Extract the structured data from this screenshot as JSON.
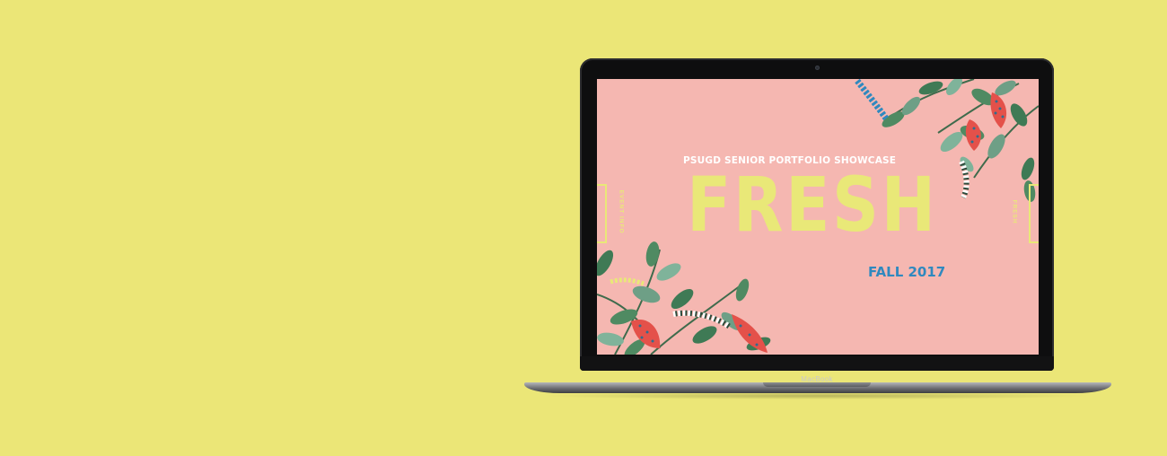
{
  "screen": {
    "subtitle": "PSUGD SENIOR PORTFOLIO SHOWCASE",
    "title": "FRESH",
    "date": "FALL 2017",
    "left_nav": "EVENT INFO",
    "right_nav": "FRESH"
  },
  "device": {
    "label": "MacBook"
  },
  "colors": {
    "page_background": "#ebe677",
    "screen_background": "#f5b7b1",
    "title_yellow": "#e9e878",
    "date_blue": "#2f89bf"
  }
}
